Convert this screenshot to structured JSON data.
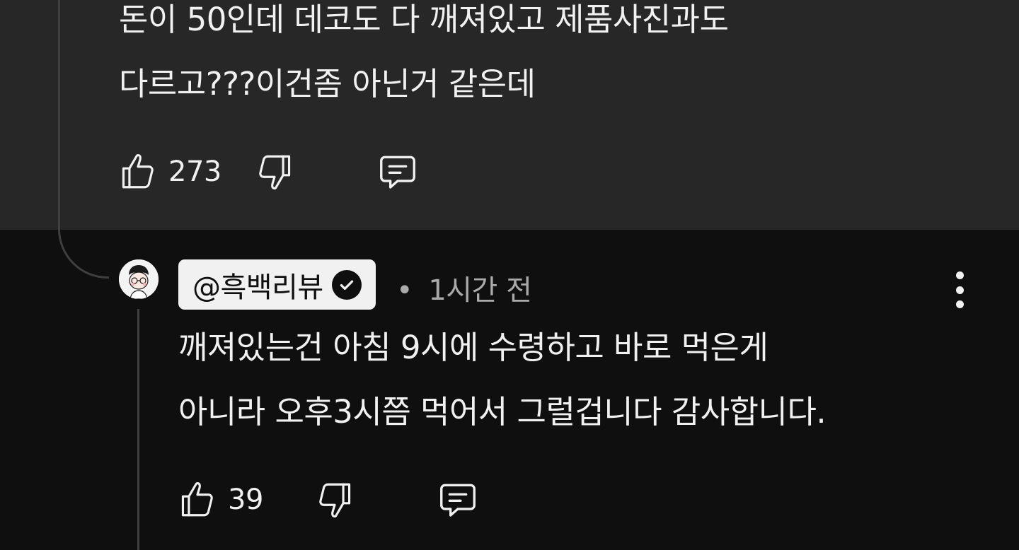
{
  "parent_comment": {
    "text_lines": [
      "돈이 50인데 데코도 다 깨져있고 제품사진과도",
      "다르고???이건좀 아닌거 같은데"
    ],
    "like_count": "273"
  },
  "reply": {
    "author": "@흑백리뷰",
    "verified": true,
    "separator": "•",
    "timestamp": "1시간 전",
    "text_lines": [
      "깨져있는건 아침 9시에 수령하고 바로 먹은게",
      "아니라 오후3시쯤 먹어서 그럴겁니다 감사합니다."
    ],
    "like_count": "39"
  },
  "colors": {
    "parent_background": "#272727",
    "page_background": "#0f0f0f",
    "text_primary": "#f1f1f1",
    "text_secondary": "#aaaaaa",
    "thread_line": "#3f3f3f",
    "author_chip_background": "#f1f1f1"
  },
  "icons": [
    "thumbs-up-icon",
    "thumbs-down-icon",
    "reply-comment-icon",
    "verified-check-icon",
    "more-vertical-icon"
  ]
}
